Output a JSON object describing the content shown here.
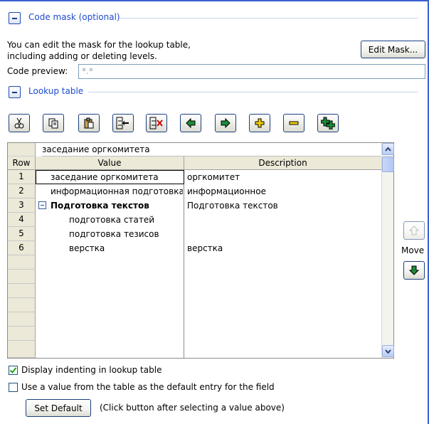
{
  "code_mask": {
    "title": "Code mask (optional)",
    "description_line1": "You can edit the mask for the lookup table,",
    "description_line2": "including adding or deleting levels.",
    "edit_mask_label": "Edit Mask...",
    "preview_label": "Code preview:",
    "preview_value": "*.*"
  },
  "lookup": {
    "title": "Lookup table",
    "toolbar_icons": [
      "cut-icon",
      "copy-icon",
      "paste-icon",
      "insert-level-icon",
      "delete-level-icon",
      "move-left-icon",
      "move-right-icon",
      "add-icon",
      "remove-icon",
      "add-multiple-icon"
    ],
    "edit_value": "заседание оргкомитета",
    "columns": {
      "row": "Row",
      "value": "Value",
      "description": "Description"
    },
    "rows": [
      {
        "row": "1",
        "value": "заседание оргкомитета",
        "description": "оргкомитет"
      },
      {
        "row": "2",
        "value": "информационная подготовка",
        "description": "информационное"
      },
      {
        "row": "3",
        "value": "Подготовка текстов",
        "description": "Подготовка текстов"
      },
      {
        "row": "4",
        "value": "подготовка статей",
        "description": ""
      },
      {
        "row": "5",
        "value": "подготовка тезисов",
        "description": ""
      },
      {
        "row": "6",
        "value": "верстка",
        "description": "верстка"
      }
    ],
    "move_label": "Move"
  },
  "options": {
    "display_indenting_label": "Display indenting in lookup table",
    "display_indenting_checked": true,
    "use_default_label": "Use a value from the table as the default entry for the field",
    "use_default_checked": false,
    "set_default_label": "Set Default",
    "set_default_hint": "(Click button after selecting a value above)"
  }
}
